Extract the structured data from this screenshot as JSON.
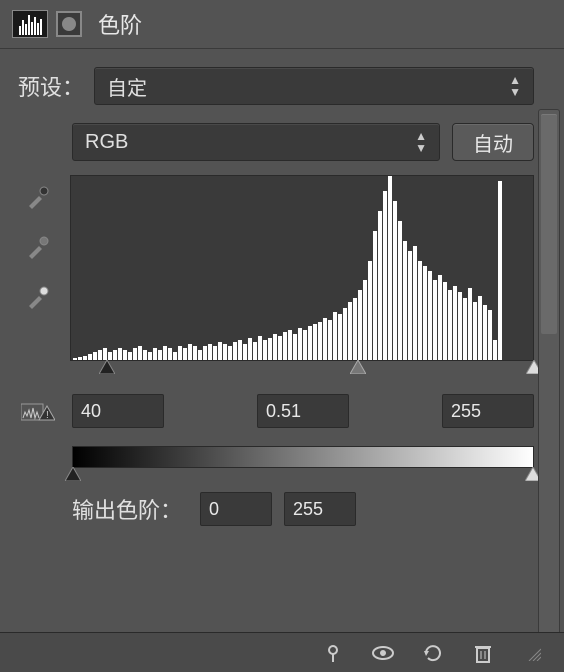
{
  "header": {
    "title": "色阶"
  },
  "preset": {
    "label": "预设：",
    "value": "自定"
  },
  "channel": {
    "value": "RGB",
    "auto_label": "自动"
  },
  "eyedroppers": [
    "black-point",
    "gray-point",
    "white-point"
  ],
  "input_levels": {
    "shadow": "40",
    "midtone": "0.51",
    "highlight": "255"
  },
  "output": {
    "label": "输出色阶：",
    "shadow": "0",
    "highlight": "255"
  },
  "chart_data": {
    "type": "bar",
    "title": "",
    "xlabel": "",
    "ylabel": "",
    "xlim": [
      0,
      255
    ],
    "categories": [
      0,
      3,
      6,
      9,
      12,
      15,
      18,
      21,
      24,
      27,
      30,
      33,
      36,
      39,
      42,
      45,
      48,
      51,
      54,
      57,
      60,
      63,
      66,
      69,
      72,
      75,
      78,
      81,
      84,
      87,
      90,
      93,
      96,
      99,
      102,
      105,
      108,
      111,
      114,
      117,
      120,
      123,
      126,
      129,
      132,
      135,
      138,
      141,
      144,
      147,
      150,
      153,
      156,
      159,
      162,
      165,
      168,
      171,
      174,
      177,
      180,
      183,
      186,
      189,
      192,
      195,
      198,
      201,
      204,
      207,
      210,
      213,
      216,
      219,
      222,
      225,
      228,
      231,
      234,
      237,
      240,
      243,
      246,
      249,
      252,
      255
    ],
    "values": [
      2,
      3,
      4,
      6,
      8,
      10,
      12,
      8,
      10,
      12,
      10,
      8,
      12,
      14,
      10,
      8,
      12,
      10,
      14,
      12,
      8,
      14,
      12,
      16,
      14,
      10,
      14,
      16,
      14,
      18,
      16,
      14,
      18,
      20,
      16,
      22,
      18,
      24,
      20,
      22,
      26,
      24,
      28,
      30,
      26,
      32,
      30,
      34,
      36,
      38,
      42,
      40,
      48,
      46,
      52,
      58,
      62,
      70,
      80,
      100,
      130,
      150,
      170,
      185,
      160,
      140,
      120,
      110,
      115,
      100,
      95,
      90,
      80,
      85,
      78,
      70,
      74,
      68,
      62,
      72,
      58,
      64,
      55,
      50,
      20,
      180
    ],
    "sliders": {
      "shadow_pos_pct": 8,
      "midtone_pos_pct": 62,
      "highlight_pos_pct": 100
    }
  }
}
